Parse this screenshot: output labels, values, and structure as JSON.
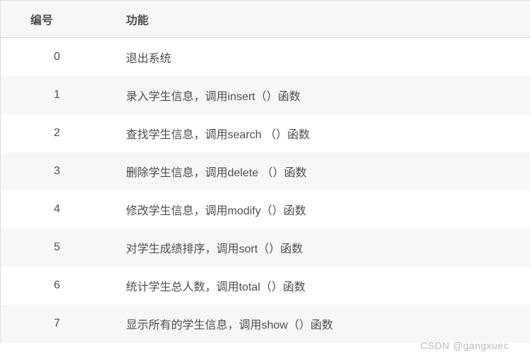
{
  "table": {
    "headers": {
      "col1": "编号",
      "col2": "功能"
    },
    "rows": [
      {
        "id": "0",
        "desc": "退出系统"
      },
      {
        "id": "1",
        "desc": "录入学生信息，调用insert（）函数"
      },
      {
        "id": "2",
        "desc": "查找学生信息，调用search （）函数"
      },
      {
        "id": "3",
        "desc": "删除学生信息，调用delete （）函数"
      },
      {
        "id": "4",
        "desc": "修改学生信息，调用modify（）函数"
      },
      {
        "id": "5",
        "desc": "对学生成绩排序，调用sort（）函数"
      },
      {
        "id": "6",
        "desc": "统计学生总人数，调用total（）函数"
      },
      {
        "id": "7",
        "desc": "显示所有的学生信息，调用show（）函数"
      }
    ]
  },
  "watermark": "CSDN @gangxuec"
}
